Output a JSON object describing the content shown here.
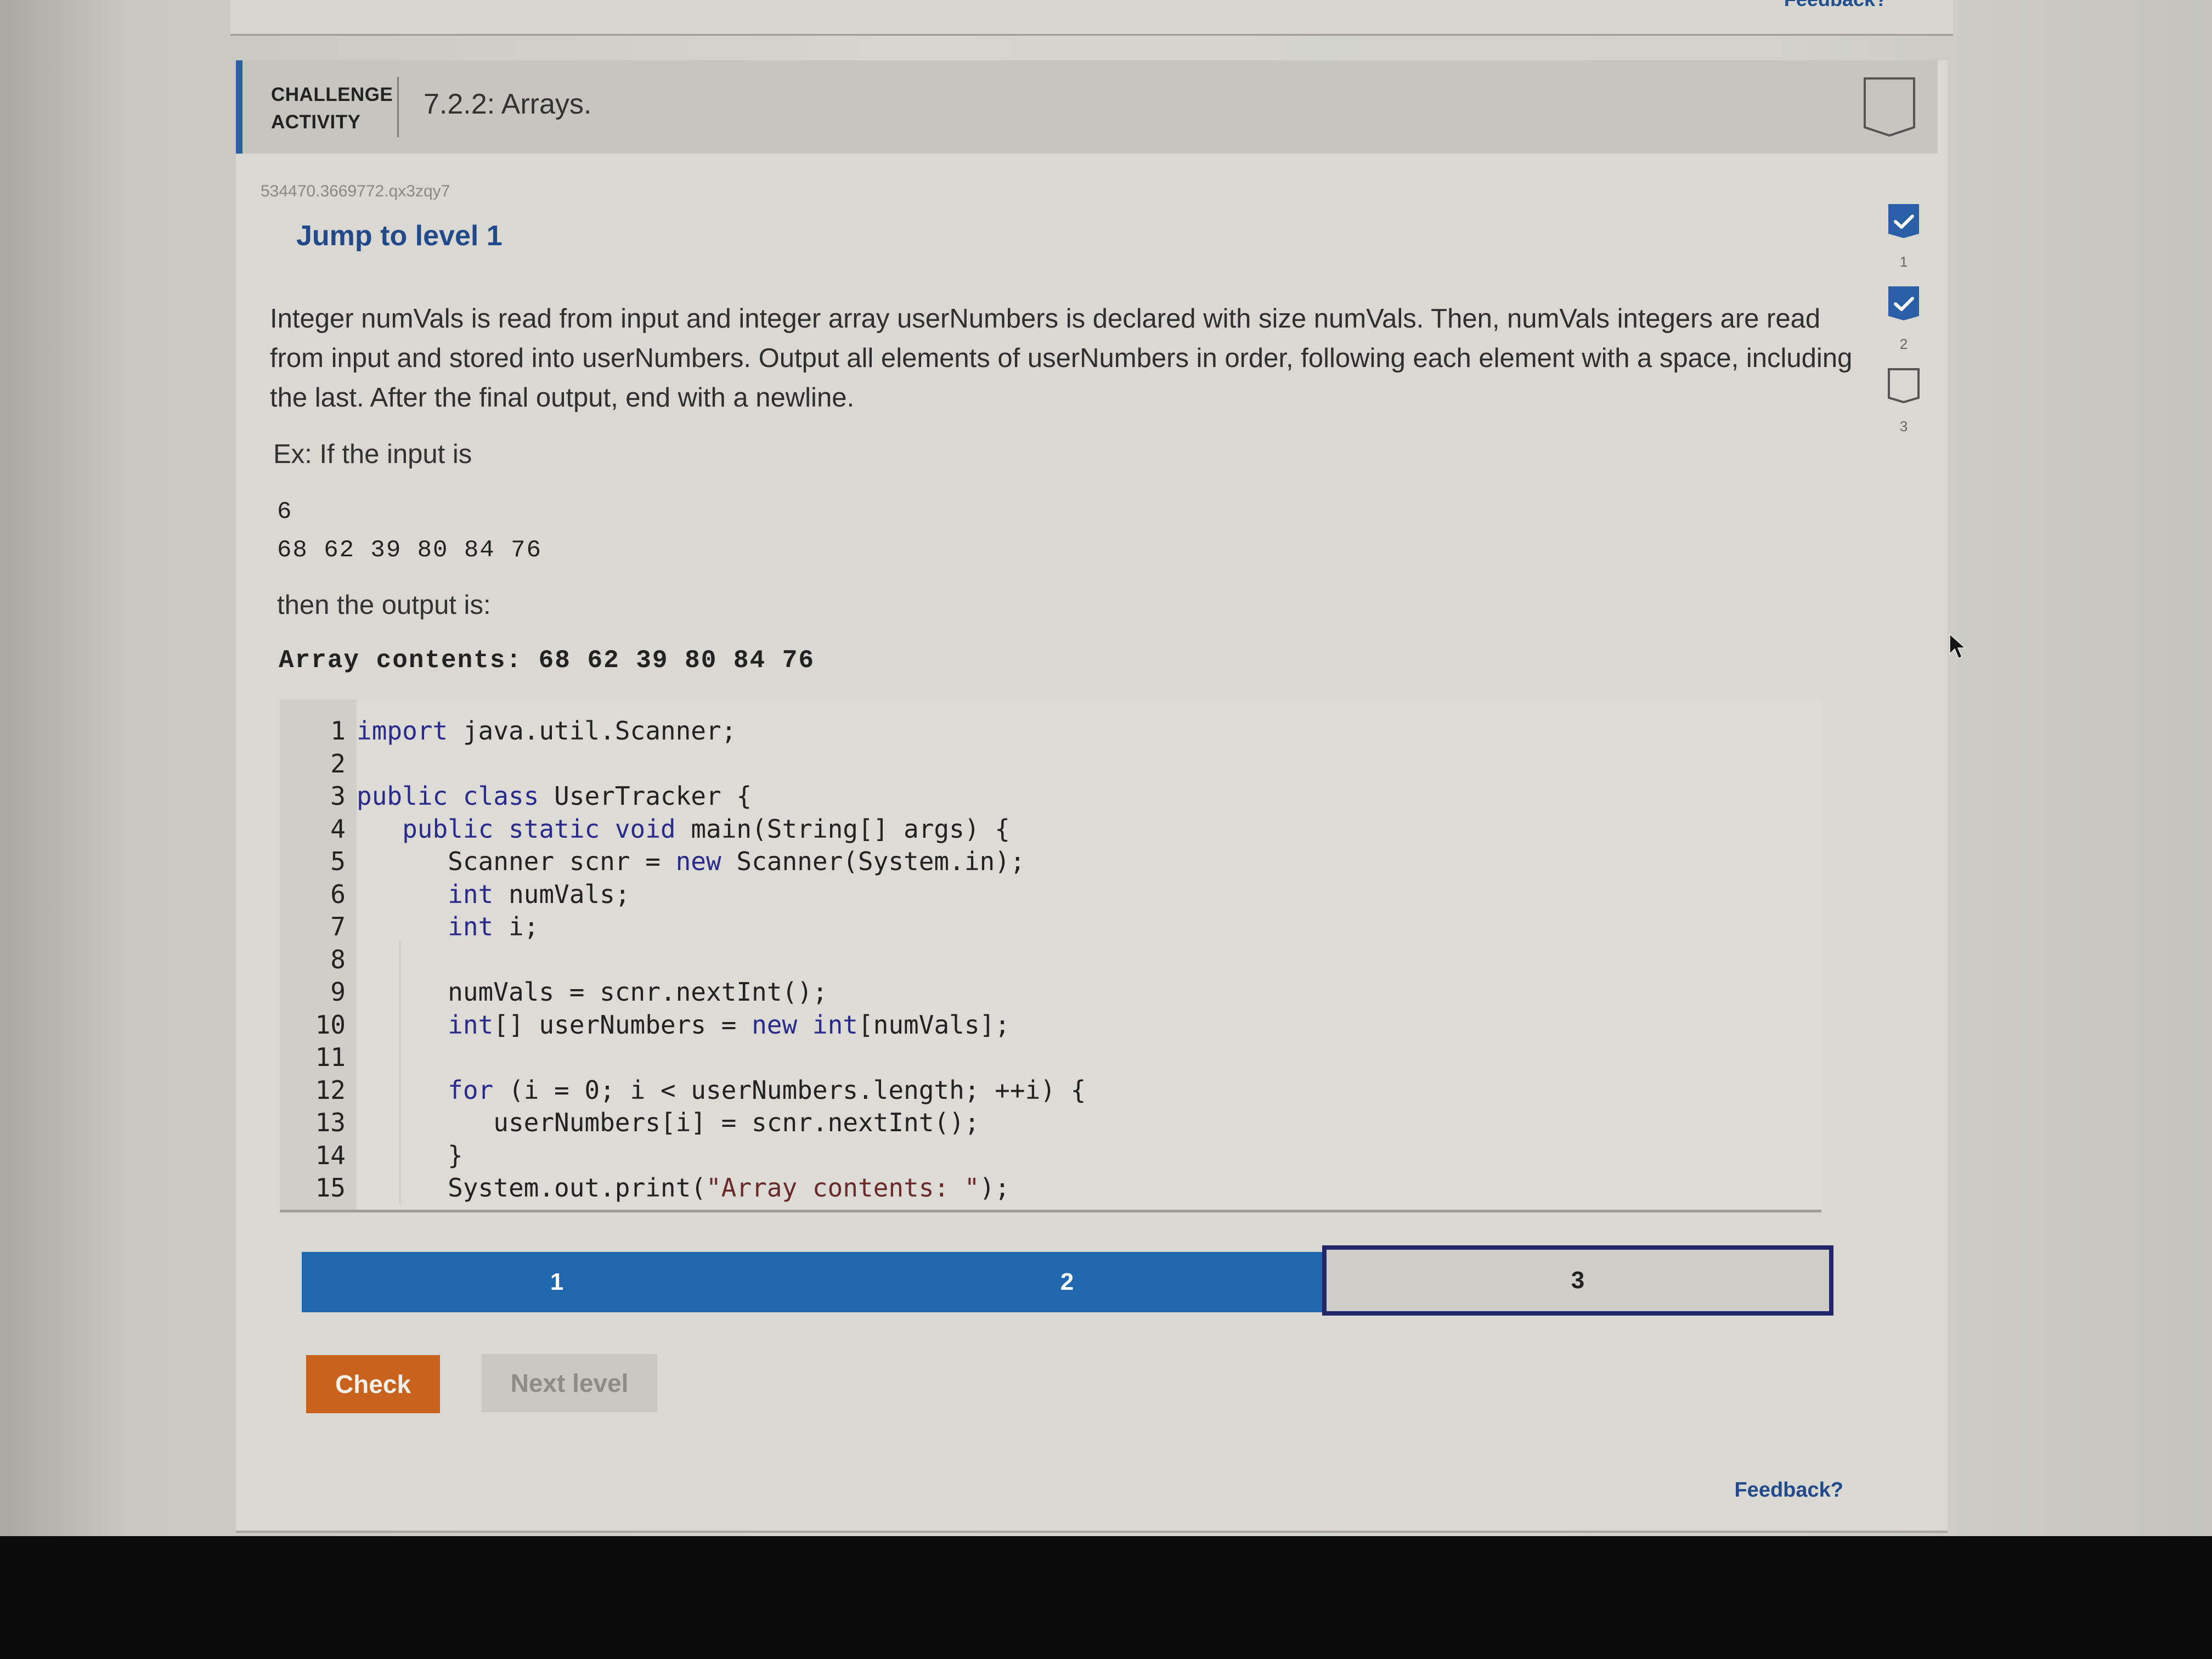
{
  "previous_card": {
    "feedback_label": "Feedback?"
  },
  "header": {
    "type_line1": "CHALLENGE",
    "type_line2": "ACTIVITY",
    "title": "7.2.2: Arrays."
  },
  "activity_id": "534470.3669772.qx3zqy7",
  "jump_link": "Jump to level 1",
  "level_indicators": [
    {
      "label": "1",
      "completed": true
    },
    {
      "label": "2",
      "completed": true
    },
    {
      "label": "3",
      "completed": false
    }
  ],
  "prompt": "Integer numVals is read from input and integer array userNumbers is declared with size numVals. Then, numVals integers are read from input and stored into userNumbers. Output all elements of userNumbers in order, following each element with a space, including the last. After the final output, end with a newline.",
  "example": {
    "intro": "Ex: If the input is",
    "input_line1": "6",
    "input_line2": "68 62 39 80 84 76",
    "then_label": "then the output is:",
    "output": "Array contents: 68 62 39 80 84 76"
  },
  "editor": {
    "lines": [
      {
        "n": "1",
        "code": "import java.util.Scanner;"
      },
      {
        "n": "2",
        "code": ""
      },
      {
        "n": "3",
        "code": "public class UserTracker {"
      },
      {
        "n": "4",
        "code": "   public static void main(String[] args) {"
      },
      {
        "n": "5",
        "code": "      Scanner scnr = new Scanner(System.in);"
      },
      {
        "n": "6",
        "code": "      int numVals;"
      },
      {
        "n": "7",
        "code": "      int i;"
      },
      {
        "n": "8",
        "code": ""
      },
      {
        "n": "9",
        "code": "      numVals = scnr.nextInt();"
      },
      {
        "n": "10",
        "code": "      int[] userNumbers = new int[numVals];"
      },
      {
        "n": "11",
        "code": ""
      },
      {
        "n": "12",
        "code": "      for (i = 0; i < userNumbers.length; ++i) {"
      },
      {
        "n": "13",
        "code": "         userNumbers[i] = scnr.nextInt();"
      },
      {
        "n": "14",
        "code": "      }"
      },
      {
        "n": "15",
        "code": "      System.out.print(\"Array contents: \");"
      }
    ]
  },
  "progress": {
    "segments": [
      {
        "label": "1",
        "state": "done"
      },
      {
        "label": "2",
        "state": "done"
      },
      {
        "label": "3",
        "state": "current"
      }
    ]
  },
  "buttons": {
    "check": "Check",
    "next_level": "Next level"
  },
  "feedback_label": "Feedback?",
  "colors": {
    "accent_blue": "#2167ad",
    "check_orange": "#c8621c",
    "link_blue": "#224a8a",
    "current_border": "#23266b"
  }
}
